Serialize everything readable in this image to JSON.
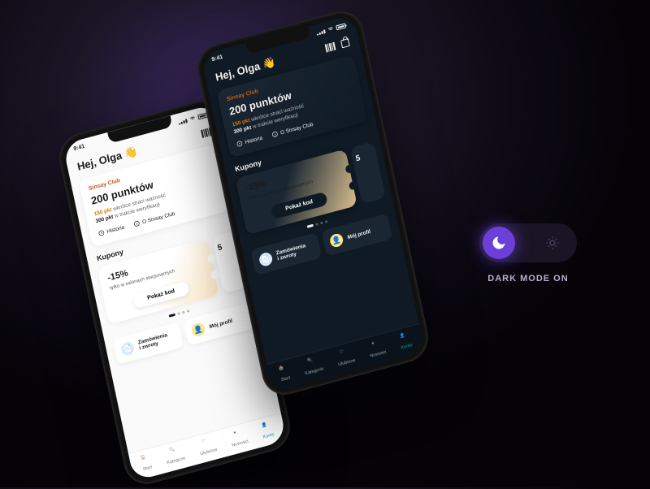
{
  "status_time": "9:41",
  "greeting": "Hej, Olga 👋",
  "club": {
    "brand": "Sinsay Club",
    "points": "200 punktów",
    "expiring_value": "150 pkt",
    "expiring_text": "wkrótce straci ważność",
    "verifying_value": "300 pkt",
    "verifying_text": "w trakcie weryfikacji",
    "history": "Historia",
    "about": "O Sinsay Club"
  },
  "coupons": {
    "title": "Kupony",
    "main_pct": "-15%",
    "main_sub": "tylko w salonach stacjonarnych",
    "show_code": "Pokaż kod",
    "peek_pct": "5"
  },
  "tiles": {
    "orders": "Zamówienia\ni zwroty",
    "profile": "Mój profil"
  },
  "tabs": {
    "start": "Start",
    "categories": "Kategorie",
    "favorites": "Ulubione",
    "news": "Nowości",
    "account": "Konto"
  },
  "toggle_label": "DARK MODE ON"
}
